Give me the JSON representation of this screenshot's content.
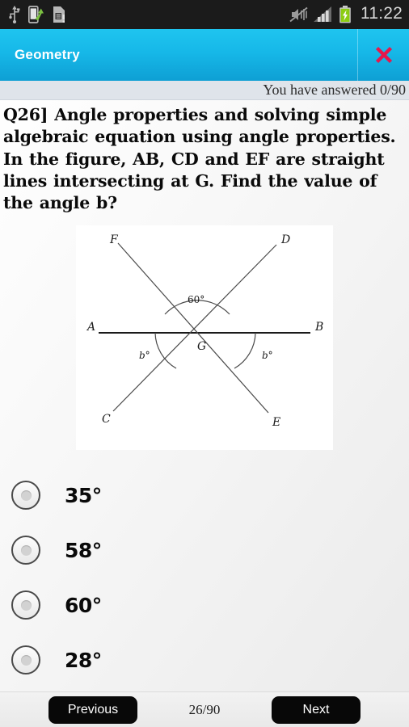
{
  "statusbar": {
    "time": "11:22",
    "icons_left": [
      "usb-icon",
      "usb-transfer-icon",
      "sim-card-alert-icon"
    ],
    "icons_right": [
      "silent-vibrate-off-icon",
      "signal-bars-icon",
      "battery-charging-icon"
    ],
    "battery_color": "#8ccc12",
    "background": "#1b1b1b"
  },
  "titlebar": {
    "title": "Geometry",
    "close_icon": "close-x-icon",
    "accent": "#16b8e8",
    "close_color": "#e8174b"
  },
  "progress": {
    "answered_text": "You have answered 0/90"
  },
  "question": {
    "text": "Q26]   Angle properties and solving simple algebraic equation using angle properties.  In the figure, AB, CD and EF are straight lines intersecting at G.  Find the value of the angle b?"
  },
  "figure": {
    "alt": "geometry-diagram-intersecting-lines",
    "labels": {
      "A": "A",
      "B": "B",
      "C": "C",
      "D": "D",
      "E": "E",
      "F": "F",
      "G": "G",
      "top_angle": "60°",
      "left_angle": "b°",
      "right_angle": "b°"
    }
  },
  "options": [
    {
      "label": "35°",
      "selected": false
    },
    {
      "label": "58°",
      "selected": false
    },
    {
      "label": "60°",
      "selected": false
    },
    {
      "label": "28°",
      "selected": false
    }
  ],
  "bottombar": {
    "previous_label": "Previous",
    "counter": "26/90",
    "next_label": "Next"
  }
}
